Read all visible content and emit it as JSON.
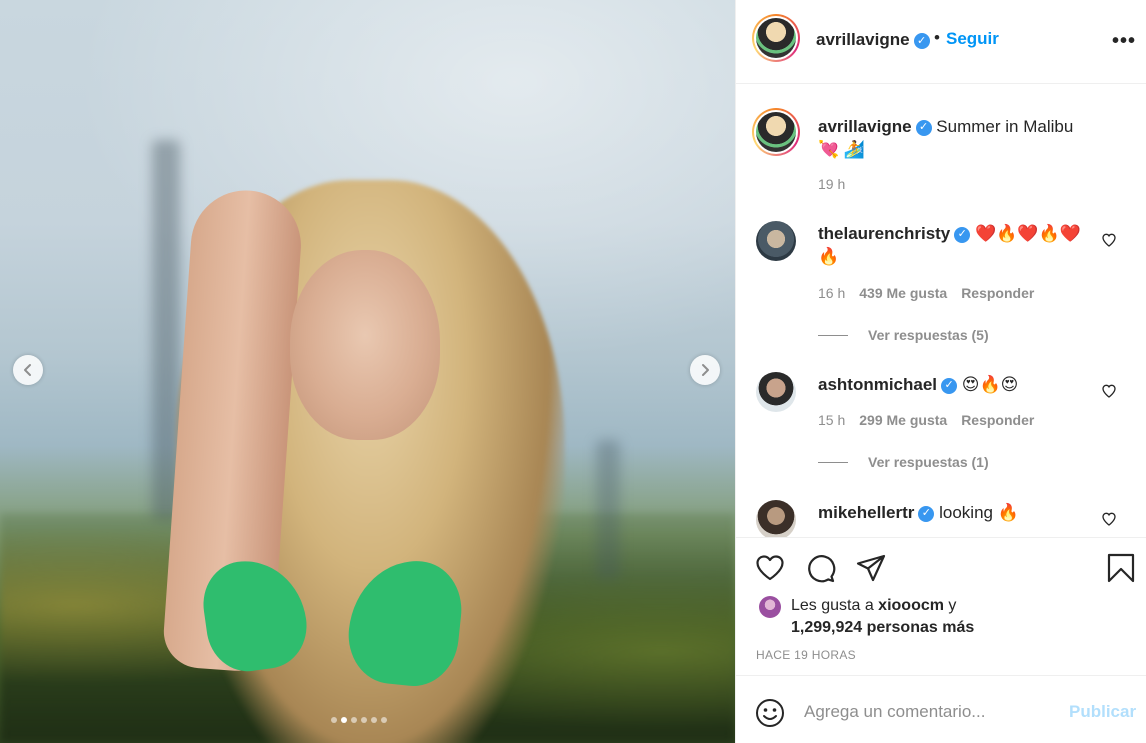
{
  "post": {
    "username": "avrillavigne",
    "follow_label": "Seguir",
    "separator": "•",
    "more_icon": "more-options-icon",
    "carousel": {
      "total": 6,
      "active": 1
    }
  },
  "caption": {
    "username": "avrillavigne",
    "text": "Summer in Malibu 💘 🏄",
    "time": "19 h"
  },
  "comments": [
    {
      "username": "thelaurenchristy",
      "text": "❤️🔥❤️🔥❤️ 🔥",
      "time": "16 h",
      "likes": "439 Me gusta",
      "reply": "Responder",
      "replies": "Ver respuestas (5)"
    },
    {
      "username": "ashtonmichael",
      "text": "😍🔥😍",
      "time": "15 h",
      "likes": "299 Me gusta",
      "reply": "Responder",
      "replies": "Ver respuestas (1)"
    },
    {
      "username": "mikehellertr",
      "text": "looking 🔥"
    }
  ],
  "likes": {
    "prefix": "Les gusta a ",
    "first_user": "xiooocm",
    "joiner": " y",
    "count": "1,299,924 personas más"
  },
  "timestamp": "HACE 19 HORAS",
  "comment_box": {
    "placeholder": "Agrega un comentario...",
    "publish_label": "Publicar"
  },
  "colors": {
    "accent": "#0095f6",
    "verified": "#3897f0",
    "publish_disabled": "#b2dffc",
    "muted": "#8e8e8e"
  }
}
